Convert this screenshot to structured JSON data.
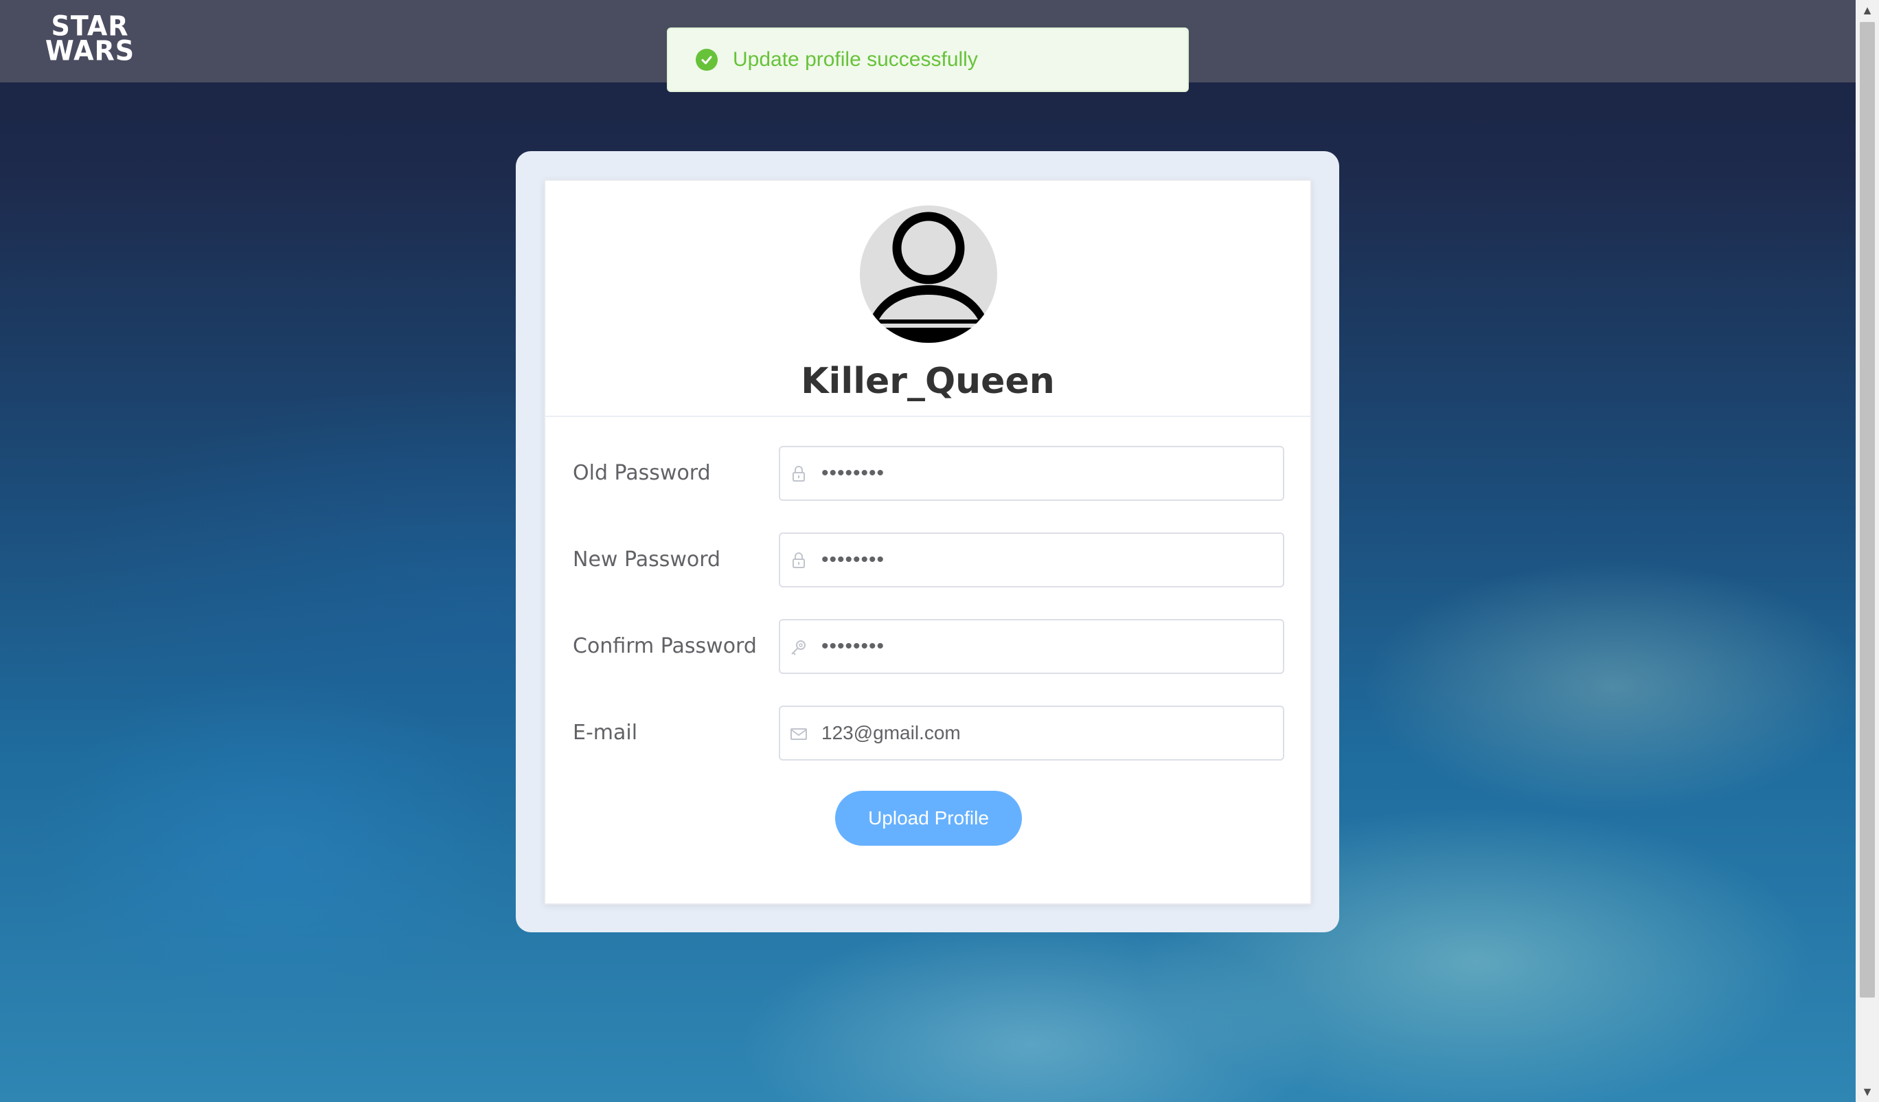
{
  "brand": {
    "logo_line1": "STAR",
    "logo_line2": "WARS"
  },
  "toast": {
    "icon": "check-circle-icon",
    "message": "Update profile successfully",
    "color": "#67c23a"
  },
  "profile": {
    "avatar_icon": "user-icon",
    "username": "Killer_Queen"
  },
  "form": {
    "old_password": {
      "label": "Old Password",
      "icon": "lock-icon",
      "value": "••••••••"
    },
    "new_password": {
      "label": "New Password",
      "icon": "lock-icon",
      "value": "••••••••"
    },
    "confirm_password": {
      "label": "Confirm Password",
      "icon": "key-icon",
      "value": "••••••••"
    },
    "email": {
      "label": "E-mail",
      "icon": "mail-icon",
      "value": "123@gmail.com"
    },
    "submit_label": "Upload Profile",
    "submit_color": "#66b1ff"
  }
}
